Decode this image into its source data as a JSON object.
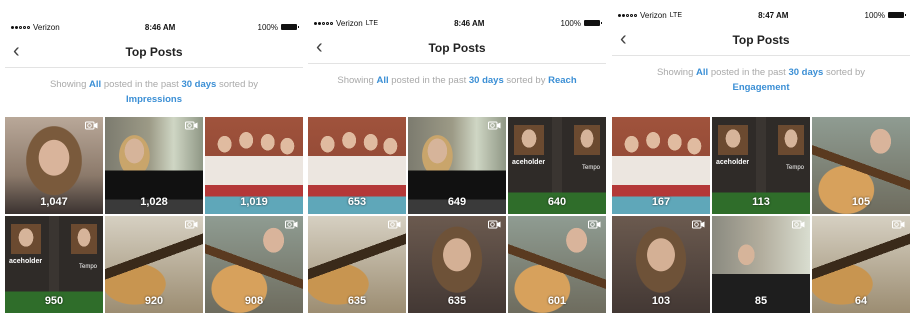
{
  "panels": [
    {
      "status": {
        "carrier": "Verizon",
        "network": "",
        "time": "8:46 AM",
        "battery": "100%",
        "wifi": true
      },
      "nav": {
        "title": "Top Posts"
      },
      "description": {
        "prefix": "Showing",
        "filter": "All",
        "mid": "posted in the past",
        "period": "30 days",
        "suffix": "sorted by",
        "metric": "Impressions"
      },
      "posts": [
        {
          "count": "1,047",
          "video": true,
          "photo": "face"
        },
        {
          "count": "1,028",
          "video": true,
          "photo": "piano"
        },
        {
          "count": "1,019",
          "video": false,
          "photo": "group2"
        },
        {
          "count": "950",
          "video": false,
          "photo": "screen"
        },
        {
          "count": "920",
          "video": true,
          "photo": "guitar"
        },
        {
          "count": "908",
          "video": true,
          "photo": "guitar2"
        }
      ]
    },
    {
      "status": {
        "carrier": "Verizon",
        "network": "LTE",
        "time": "8:46 AM",
        "battery": "100%",
        "wifi": false
      },
      "nav": {
        "title": "Top Posts"
      },
      "description": {
        "prefix": "Showing",
        "filter": "All",
        "mid": "posted in the past",
        "period": "30 days",
        "suffix": "sorted by",
        "metric": "Reach"
      },
      "posts": [
        {
          "count": "653",
          "video": false,
          "photo": "group2"
        },
        {
          "count": "649",
          "video": true,
          "photo": "piano"
        },
        {
          "count": "640",
          "video": false,
          "photo": "screen"
        },
        {
          "count": "635",
          "video": true,
          "photo": "guitar"
        },
        {
          "count": "635",
          "video": true,
          "photo": "dark"
        },
        {
          "count": "601",
          "video": true,
          "photo": "guitar2"
        }
      ]
    },
    {
      "status": {
        "carrier": "Verizon",
        "network": "LTE",
        "time": "8:47 AM",
        "battery": "100%",
        "wifi": false
      },
      "nav": {
        "title": "Top Posts"
      },
      "description": {
        "prefix": "Showing",
        "filter": "All",
        "mid": "posted in the past",
        "period": "30 days",
        "suffix": "sorted by",
        "metric": "Engagement"
      },
      "posts": [
        {
          "count": "167",
          "video": false,
          "photo": "group2"
        },
        {
          "count": "113",
          "video": false,
          "photo": "screen"
        },
        {
          "count": "105",
          "video": false,
          "photo": "guitar2"
        },
        {
          "count": "103",
          "video": true,
          "photo": "dark"
        },
        {
          "count": "85",
          "video": true,
          "photo": "lamp"
        },
        {
          "count": "64",
          "video": true,
          "photo": "guitar"
        }
      ]
    }
  ],
  "screen_texts": {
    "placeholder": "aceholder",
    "tempo": "Tempo"
  },
  "colors": {
    "link": "#3b8fd5",
    "muted": "#a9a9a9"
  }
}
